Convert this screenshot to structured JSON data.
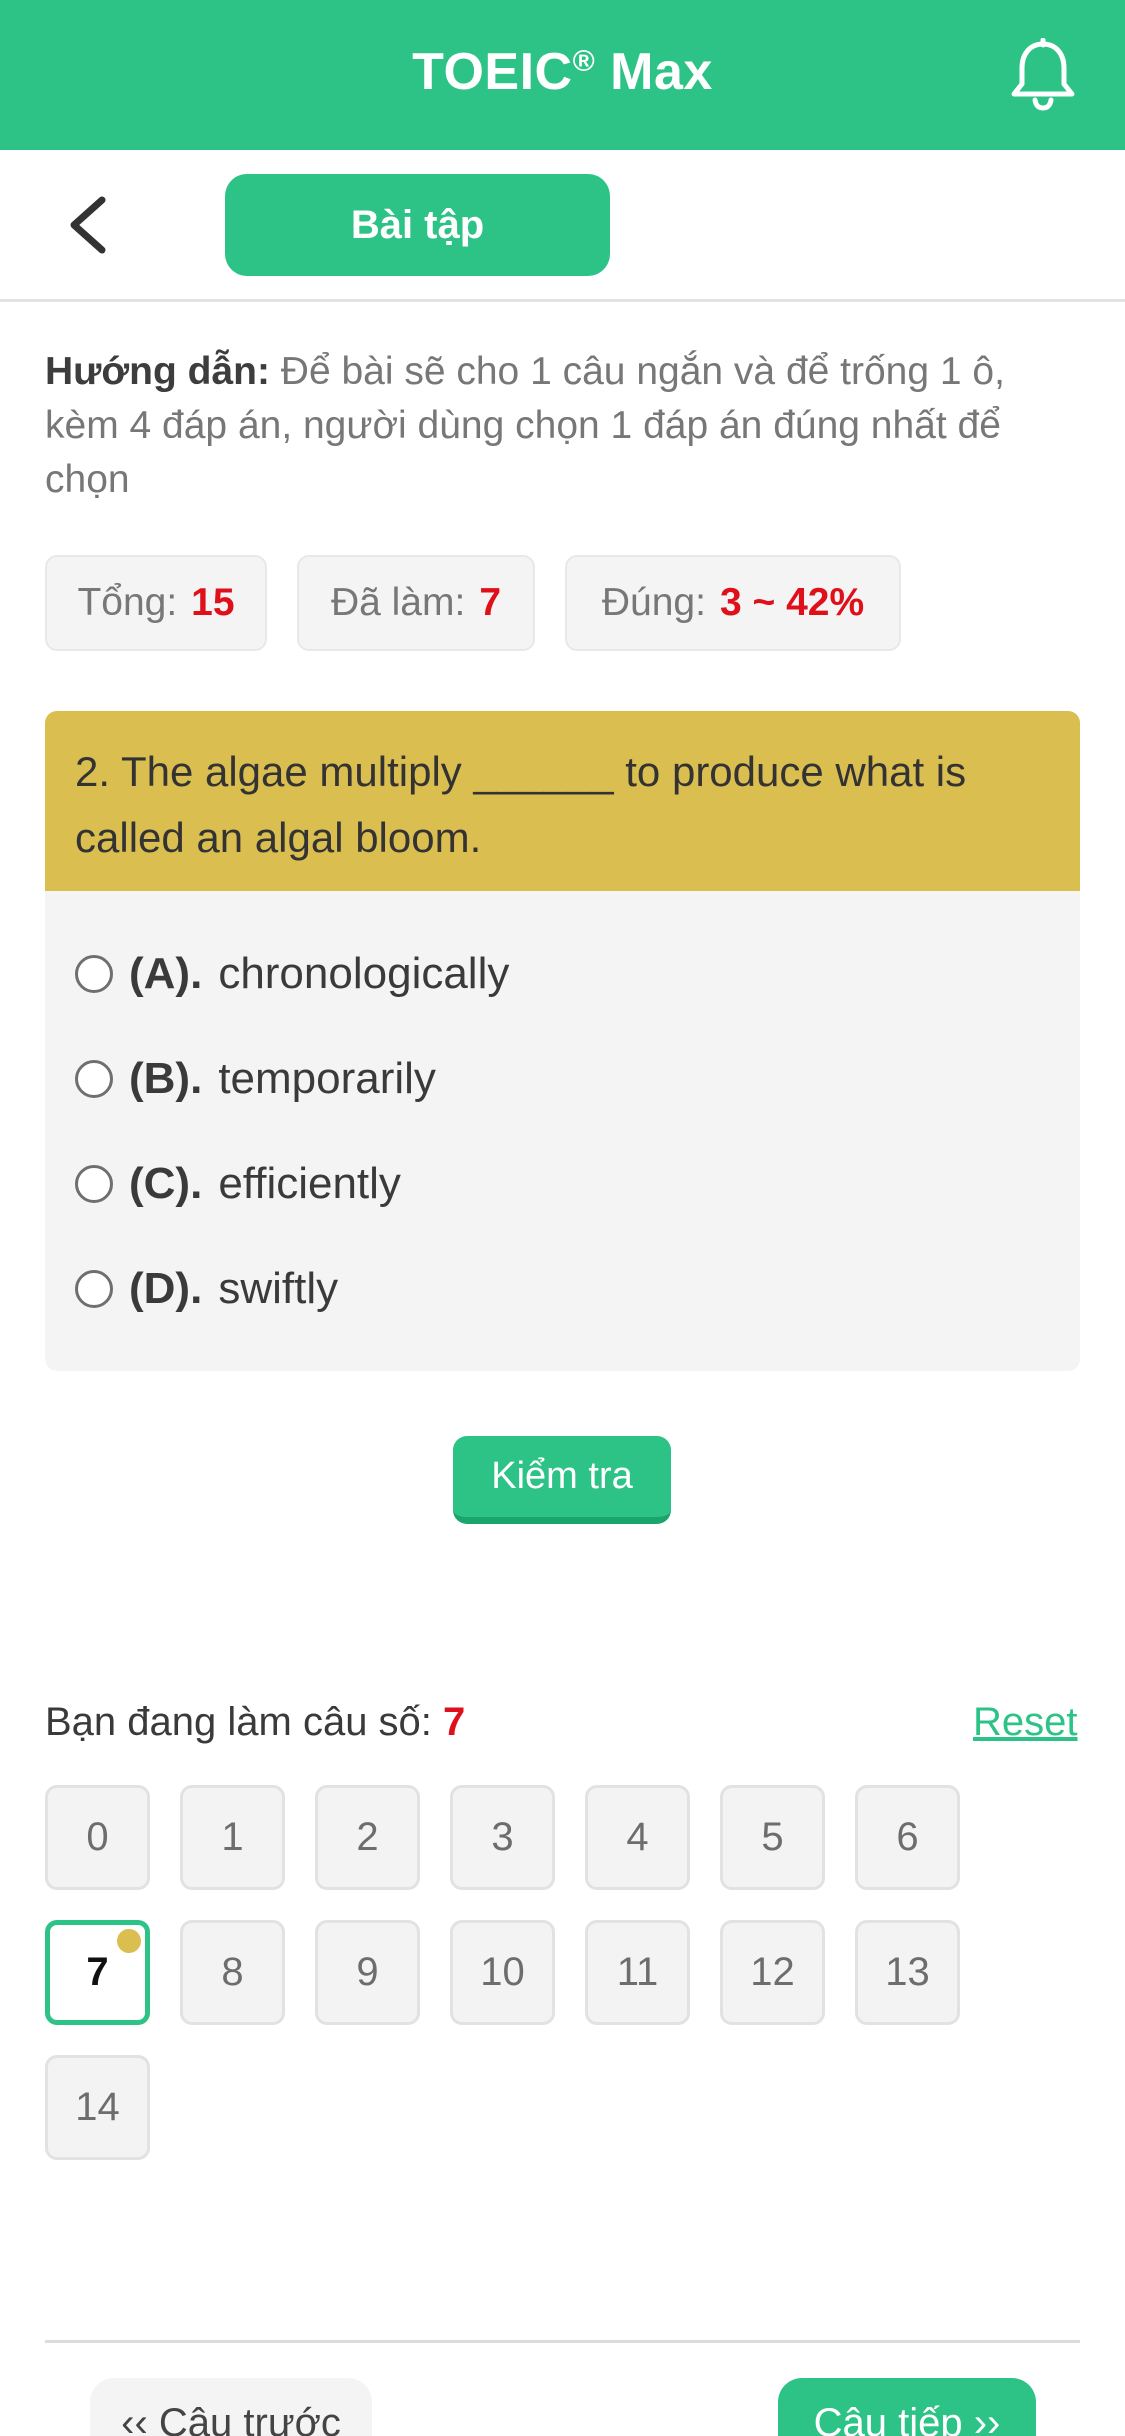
{
  "app_bar": {
    "title": "TOEIC",
    "title_sup": "®",
    "title_suffix": " Max",
    "bell_icon": "bell-icon"
  },
  "subheader": {
    "back_icon": "chevron-left-icon",
    "tab_label": "Bài tập"
  },
  "instructions": {
    "label": "Hướng dẫn:",
    "text": " Để bài sẽ cho 1 câu ngắn và để trống 1 ô, kèm 4 đáp án, người dùng chọn 1 đáp án đúng nhất để chọn"
  },
  "stats": {
    "total_label": "Tổng:",
    "total_value": "15",
    "done_label": "Đã làm:",
    "done_value": "7",
    "correct_label": "Đúng:",
    "correct_value": "3 ~ 42%"
  },
  "question": {
    "text": "2. The algae multiply ______ to produce what is called an algal bloom.",
    "options": [
      {
        "letter": "(A).",
        "text": "chronologically"
      },
      {
        "letter": "(B).",
        "text": "temporarily"
      },
      {
        "letter": "(C).",
        "text": "efficiently"
      },
      {
        "letter": "(D).",
        "text": "swiftly"
      }
    ]
  },
  "check_button": "Kiểm tra",
  "progress": {
    "current_label": "Bạn đang làm câu số:",
    "current_value": "7",
    "reset_label": "Reset",
    "numbers": [
      "0",
      "1",
      "2",
      "3",
      "4",
      "5",
      "6",
      "7",
      "8",
      "9",
      "10",
      "11",
      "12",
      "13",
      "14"
    ],
    "active_index": 7
  },
  "nav": {
    "prev_label": "‹‹ Câu trước",
    "next_label": "Câu tiếp ››"
  },
  "colors": {
    "primary": "#2dc387",
    "question_header": "#dbbe50",
    "accent_red": "#e0101a"
  }
}
